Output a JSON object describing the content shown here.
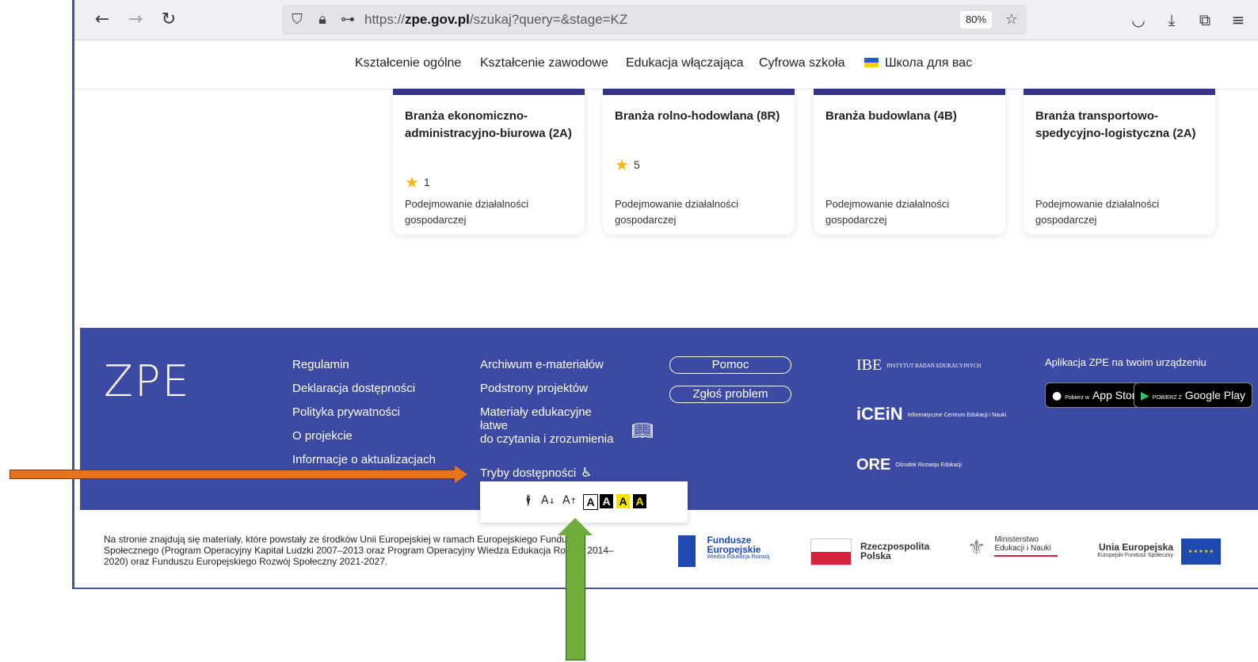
{
  "browser": {
    "url_prefix": "https://",
    "url_host": "zpe.gov.pl",
    "url_path": "/szukaj?query=&stage=KZ",
    "zoom": "80%"
  },
  "nav": {
    "items": [
      "Kształcenie ogólne",
      "Kształcenie zawodowe",
      "Edukacja włączająca",
      "Cyfrowa szkoła",
      "Школа для вас"
    ]
  },
  "cards": [
    {
      "title": "Branża ekonomiczno-administracyjno-biurowa (2A)",
      "rating": "1",
      "category": "Podejmowanie działalności gospodarczej"
    },
    {
      "title": "Branża rolno-hodowlana (8R)",
      "rating": "5",
      "category": "Podejmowanie działalności gospodarczej"
    },
    {
      "title": "Branża budowlana (4B)",
      "rating": "",
      "category": "Podejmowanie działalności gospodarczej"
    },
    {
      "title": "Branża transportowo-spedycyjno-logistyczna (2A)",
      "rating": "",
      "category": "Podejmowanie działalności gospodarczej"
    }
  ],
  "footer": {
    "logo": "ZPE",
    "col1": [
      "Regulamin",
      "Deklaracja dostępności",
      "Polityka prywatności",
      "O projekcie",
      "Informacje o aktualizacjach"
    ],
    "col2": [
      "Archiwum e-materiałów",
      "Podstrony projektów",
      "Materiały edukacyjne łatwe",
      "do czytania i zrozumienia",
      "Tryby dostępności"
    ],
    "help": "Pomoc",
    "report": "Zgłoś problem",
    "partners": {
      "ibe": "IBE",
      "ibe_sub": "INSTYTUT BADAŃ EDUKACYJNYCH",
      "icein": "iCEiN",
      "icein_sub": "Informatyczne Centrum Edukacji i Nauki",
      "ore": "ORE",
      "ore_sub": "Ośrodek Rozwoju Edukacji"
    },
    "app_label": "Aplikacja ZPE na twoim urządzeniu",
    "appstore_small": "Pobierz w",
    "appstore": "App Store",
    "googleplay_small": "POBIERZ Z",
    "googleplay": "Google Play"
  },
  "a11y_popup": {
    "font_minus": "A",
    "font_plus": "A",
    "contrast": [
      "A",
      "A",
      "A",
      "A"
    ]
  },
  "bottom": {
    "text": "Na stronie znajdują się materiały, które powstały ze środków Unii Europejskiej w ramach Europejskiego Funduszu Społecznego (Program Operacyjny Kapitał Ludzki 2007–2013 oraz Program Operacyjny Wiedza Edukacja Rozwój 2014–2020) oraz Funduszu Europejskiego Rozwój Społeczny 2021-2027.",
    "fe_title": "Fundusze Europejskie",
    "fe_sub": "Wiedza Edukacja Rozwój",
    "rp": "Rzeczpospolita Polska",
    "men": "Ministerstwo Edukacji i Nauki",
    "ue_title": "Unia Europejska",
    "ue_sub": "Europejski Fundusz Społeczny"
  },
  "colors": {
    "footer": "#3d4aa3",
    "card_accent": "#36348a",
    "arrow_orange": "#e8731f",
    "arrow_green": "#6fae3c"
  }
}
